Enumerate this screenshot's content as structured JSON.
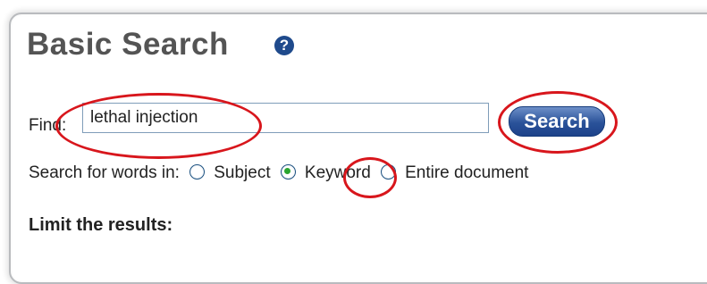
{
  "page": {
    "title": "Basic Search",
    "help_icon": "question-circle-icon"
  },
  "find": {
    "label": "Find:",
    "value": "lethal injection",
    "button_label": "Search"
  },
  "search_in": {
    "label": "Search for words in:",
    "options": [
      {
        "label": "Subject",
        "checked": false
      },
      {
        "label": "Keyword",
        "checked": true
      },
      {
        "label": "Entire document",
        "checked": false
      }
    ]
  },
  "limit": {
    "label": "Limit the results:"
  },
  "colors": {
    "callout": "#d8161c",
    "button": "#2a5299",
    "title": "#545454",
    "radio_selected": "#2aa52f"
  }
}
